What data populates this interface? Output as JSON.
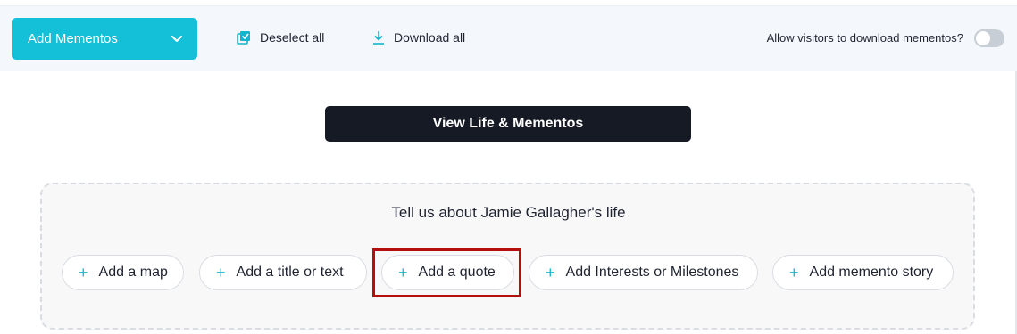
{
  "toolbar": {
    "add_mementos_label": "Add Mementos",
    "deselect_label": "Deselect all",
    "download_label": "Download all",
    "allow_label": "Allow visitors to download mementos?",
    "allow_toggle_on": false
  },
  "main": {
    "view_button_label": "View Life & Mementos",
    "tell_title": "Tell us about Jamie Gallagher's life",
    "actions": [
      {
        "label": "Add a map"
      },
      {
        "label": "Add a title or text"
      },
      {
        "label": "Add a quote",
        "highlighted": true
      },
      {
        "label": "Add Interests or Milestones"
      },
      {
        "label": "Add memento story"
      }
    ]
  },
  "colors": {
    "accent": "#14c0d8",
    "dark_button": "#161a25",
    "highlight": "#b50e0e"
  }
}
